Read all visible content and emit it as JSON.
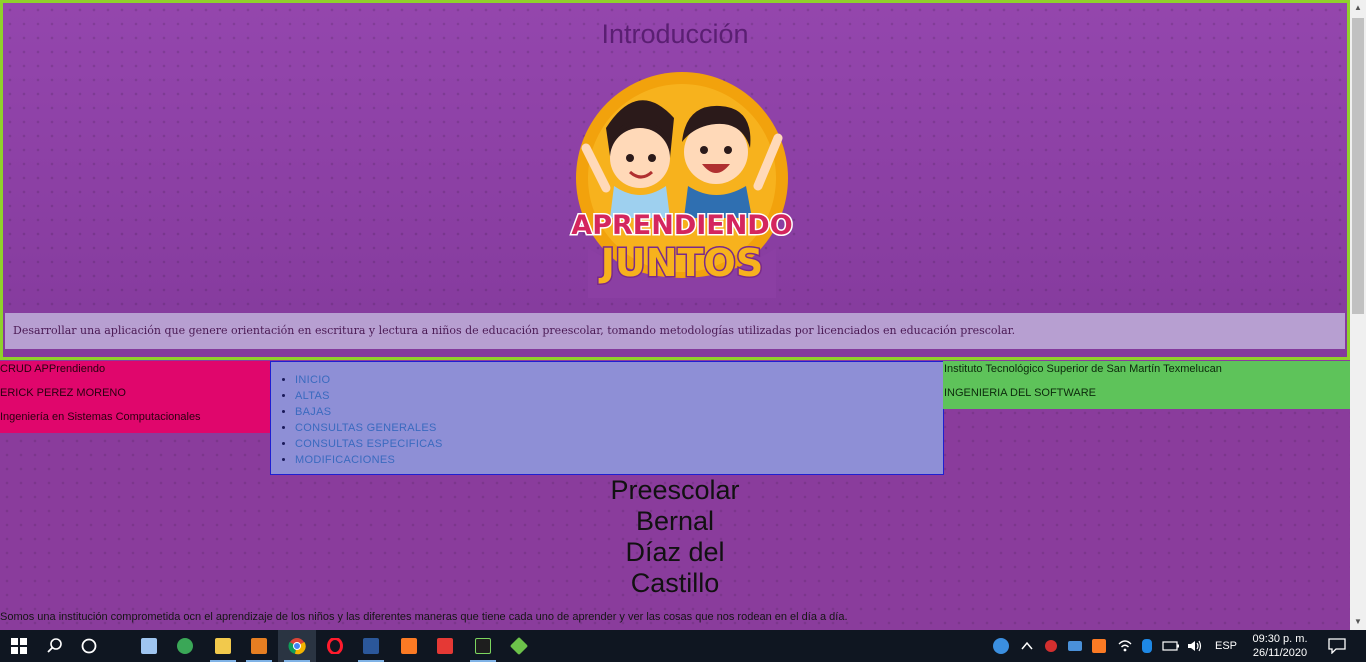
{
  "header": {
    "title": "Introducción",
    "logo_text_line1": "APRENDIENDO",
    "logo_text_line2": "JUNTOS",
    "intro_text": "Desarrollar una aplicación que genere orientación en escritura y lectura a niños de educación preescolar, tomando metodologías utilizadas por licenciados en educación prescolar."
  },
  "left_info": {
    "project": "CRUD APPrendiendo",
    "author": "ERICK PEREZ MORENO",
    "career": "Ingeniería en Sistemas Computacionales"
  },
  "nav": {
    "items": [
      "INICIO",
      "ALTAS",
      "BAJAS",
      "CONSULTAS GENERALES",
      "CONSULTAS ESPECIFICAS",
      "MODIFICACIONES"
    ]
  },
  "right_info": {
    "institute": "Instituto Tecnológico Superior de San Martín Texmelucan",
    "subject": "INGENIERIA DEL SOFTWARE"
  },
  "main": {
    "title_lines": [
      "Preescolar",
      "Bernal",
      "Díaz del",
      "Castillo"
    ],
    "mission_text": "Somos una institución comprometida ocn el aprendizaje de los niños y las diferentes maneras que tiene cada uno de aprender y ver las cosas que nos rodean en el día a día."
  },
  "taskbar": {
    "language": "ESP",
    "time": "09:30 p. m.",
    "date": "26/11/2020",
    "icons": [
      "windows-start-icon",
      "search-icon",
      "cortana-icon",
      "box-app-icon",
      "edge-app-icon",
      "file-explorer-icon",
      "sublime-text-icon",
      "chrome-icon",
      "opera-icon",
      "word-icon",
      "xampp-icon",
      "pdf-app-icon",
      "terminal-icon",
      "git-icon"
    ]
  },
  "colors": {
    "page_bg": "#8a3c9c",
    "header_border": "#8fd12b",
    "left_box": "#e0066c",
    "nav_bg": "#8e8fd6",
    "right_box": "#5ec35a",
    "taskbar": "#0f1621"
  }
}
